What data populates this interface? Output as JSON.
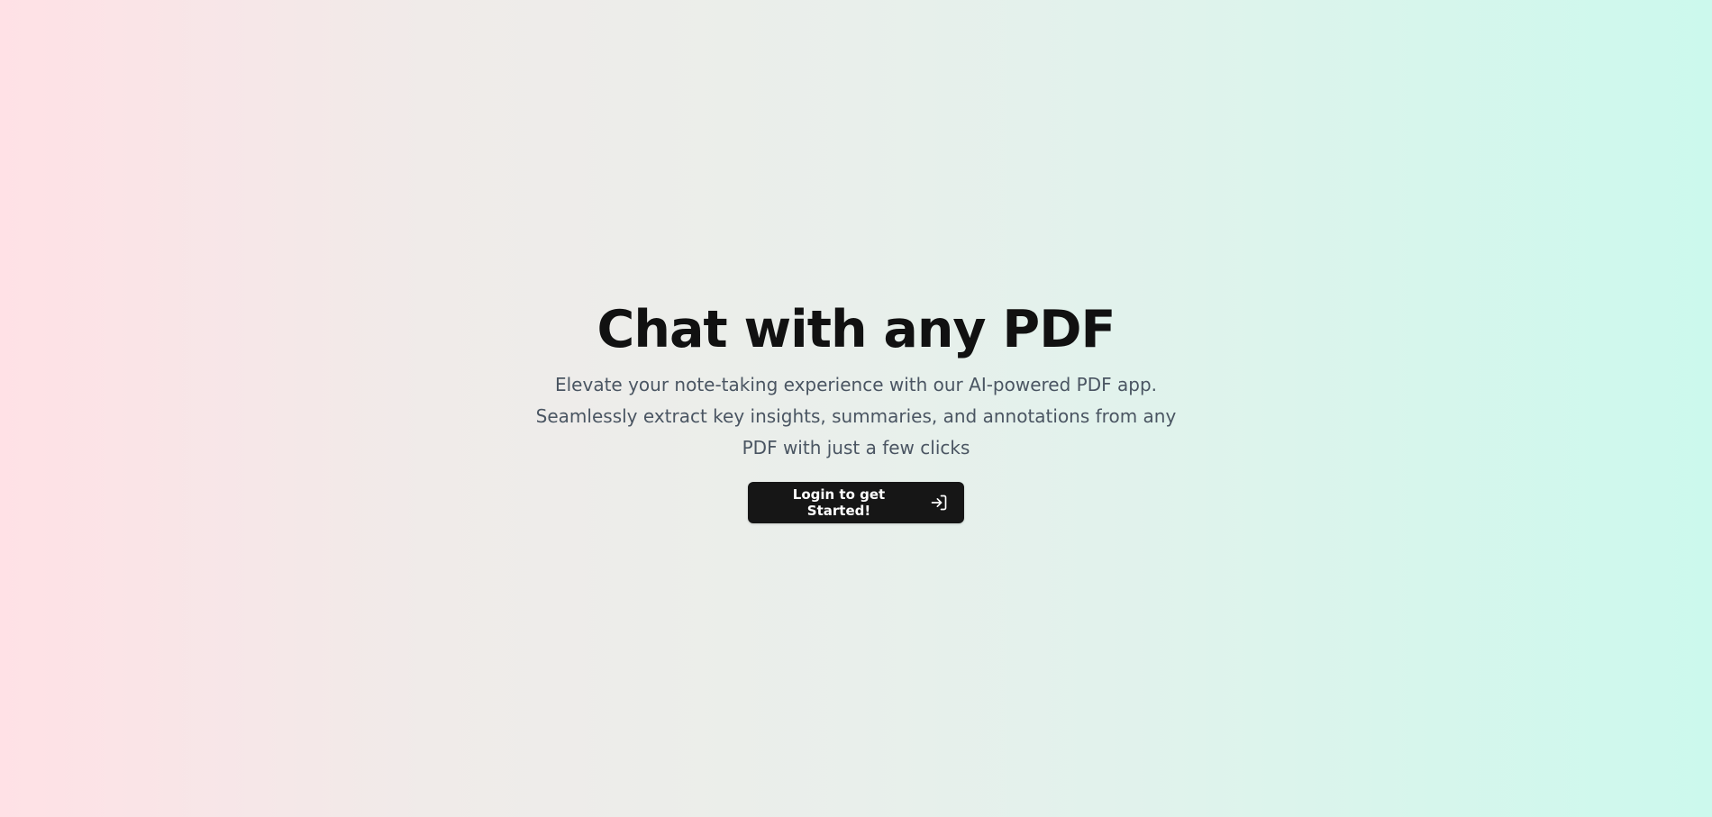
{
  "hero": {
    "title": "Chat with any PDF",
    "subtitle": "Elevate your note-taking experience with our AI-powered PDF app. Seamlessly extract key insights, summaries, and annotations from any PDF with just a few clicks",
    "cta_label": "Login to get Started!",
    "cta_icon": "login-arrow-icon"
  },
  "colors": {
    "gradient_left": "#ffe1e6",
    "gradient_right": "#ccf9ed",
    "button_bg": "#161616",
    "title_text": "#111111",
    "subtitle_text": "#4a5562"
  }
}
